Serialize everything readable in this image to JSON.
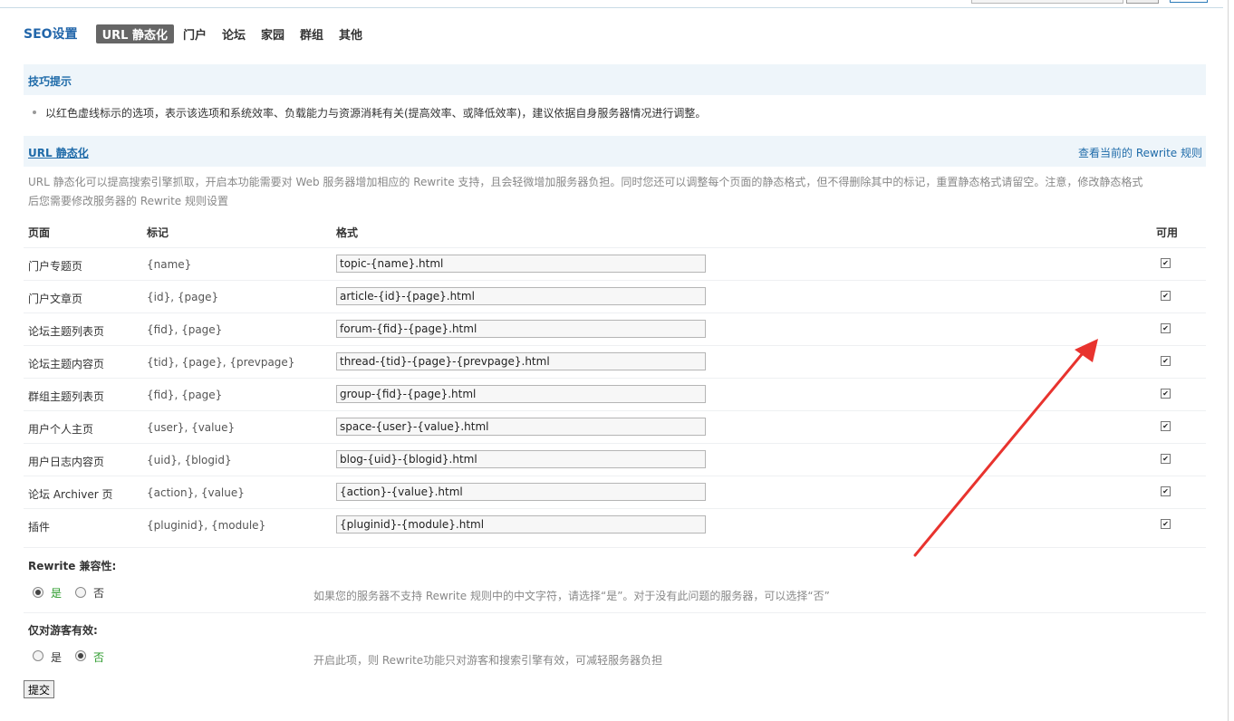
{
  "nav": {
    "title": "SEO设置",
    "tabs": [
      {
        "label": "URL 静态化",
        "active": true
      },
      {
        "label": "门户"
      },
      {
        "label": "论坛"
      },
      {
        "label": "家园"
      },
      {
        "label": "群组"
      },
      {
        "label": "其他"
      }
    ]
  },
  "tips": {
    "title": "技巧提示",
    "text": "以红色虚线标示的选项，表示该选项和系统效率、负载能力与资源消耗有关(提高效率、或降低效率)，建议依据自身服务器情况进行调整。"
  },
  "section": {
    "title": "URL 静态化",
    "link": "查看当前的 Rewrite 规则",
    "description": "URL 静态化可以提高搜索引擎抓取，开启本功能需要对 Web 服务器增加相应的 Rewrite 支持，且会轻微增加服务器负担。同时您还可以调整每个页面的静态格式，但不得删除其中的标记，重置静态格式请留空。注意，修改静态格式后您需要修改服务器的 Rewrite 规则设置"
  },
  "table": {
    "headers": {
      "page": "页面",
      "mark": "标记",
      "format": "格式",
      "enabled": "可用"
    },
    "rows": [
      {
        "page": "门户专题页",
        "mark": "{name}",
        "format": "topic-{name}.html",
        "enabled": true
      },
      {
        "page": "门户文章页",
        "mark": "{id}, {page}",
        "format": "article-{id}-{page}.html",
        "enabled": true
      },
      {
        "page": "论坛主题列表页",
        "mark": "{fid}, {page}",
        "format": "forum-{fid}-{page}.html",
        "enabled": true
      },
      {
        "page": "论坛主题内容页",
        "mark": "{tid}, {page}, {prevpage}",
        "format": "thread-{tid}-{page}-{prevpage}.html",
        "enabled": true
      },
      {
        "page": "群组主题列表页",
        "mark": "{fid}, {page}",
        "format": "group-{fid}-{page}.html",
        "enabled": true
      },
      {
        "page": "用户个人主页",
        "mark": "{user}, {value}",
        "format": "space-{user}-{value}.html",
        "enabled": true
      },
      {
        "page": "用户日志内容页",
        "mark": "{uid}, {blogid}",
        "format": "blog-{uid}-{blogid}.html",
        "enabled": true
      },
      {
        "page": "论坛 Archiver 页",
        "mark": "{action}, {value}",
        "format": "{action}-{value}.html",
        "enabled": true
      },
      {
        "page": "插件",
        "mark": "{pluginid}, {module}",
        "format": "{pluginid}-{module}.html",
        "enabled": true
      }
    ]
  },
  "options": {
    "rewrite_compat": {
      "title": "Rewrite 兼容性:",
      "yes": "是",
      "no": "否",
      "selected": "yes",
      "tip": "如果您的服务器不支持 Rewrite 规则中的中文字符，请选择“是”。对于没有此问题的服务器，可以选择“否”"
    },
    "guest_only": {
      "title": "仅对游客有效:",
      "yes": "是",
      "no": "否",
      "selected": "no",
      "tip": "开启此项，则 Rewrite功能只对游客和搜索引擎有效，可减轻服务器负担"
    }
  },
  "submit_label": "提交",
  "colors": {
    "accent": "#1f6ba9",
    "bar_bg": "#eef5fa",
    "active_tab_bg": "#666666",
    "selected_option": "#2a9a2a",
    "annotation_arrow": "#e8332e"
  }
}
